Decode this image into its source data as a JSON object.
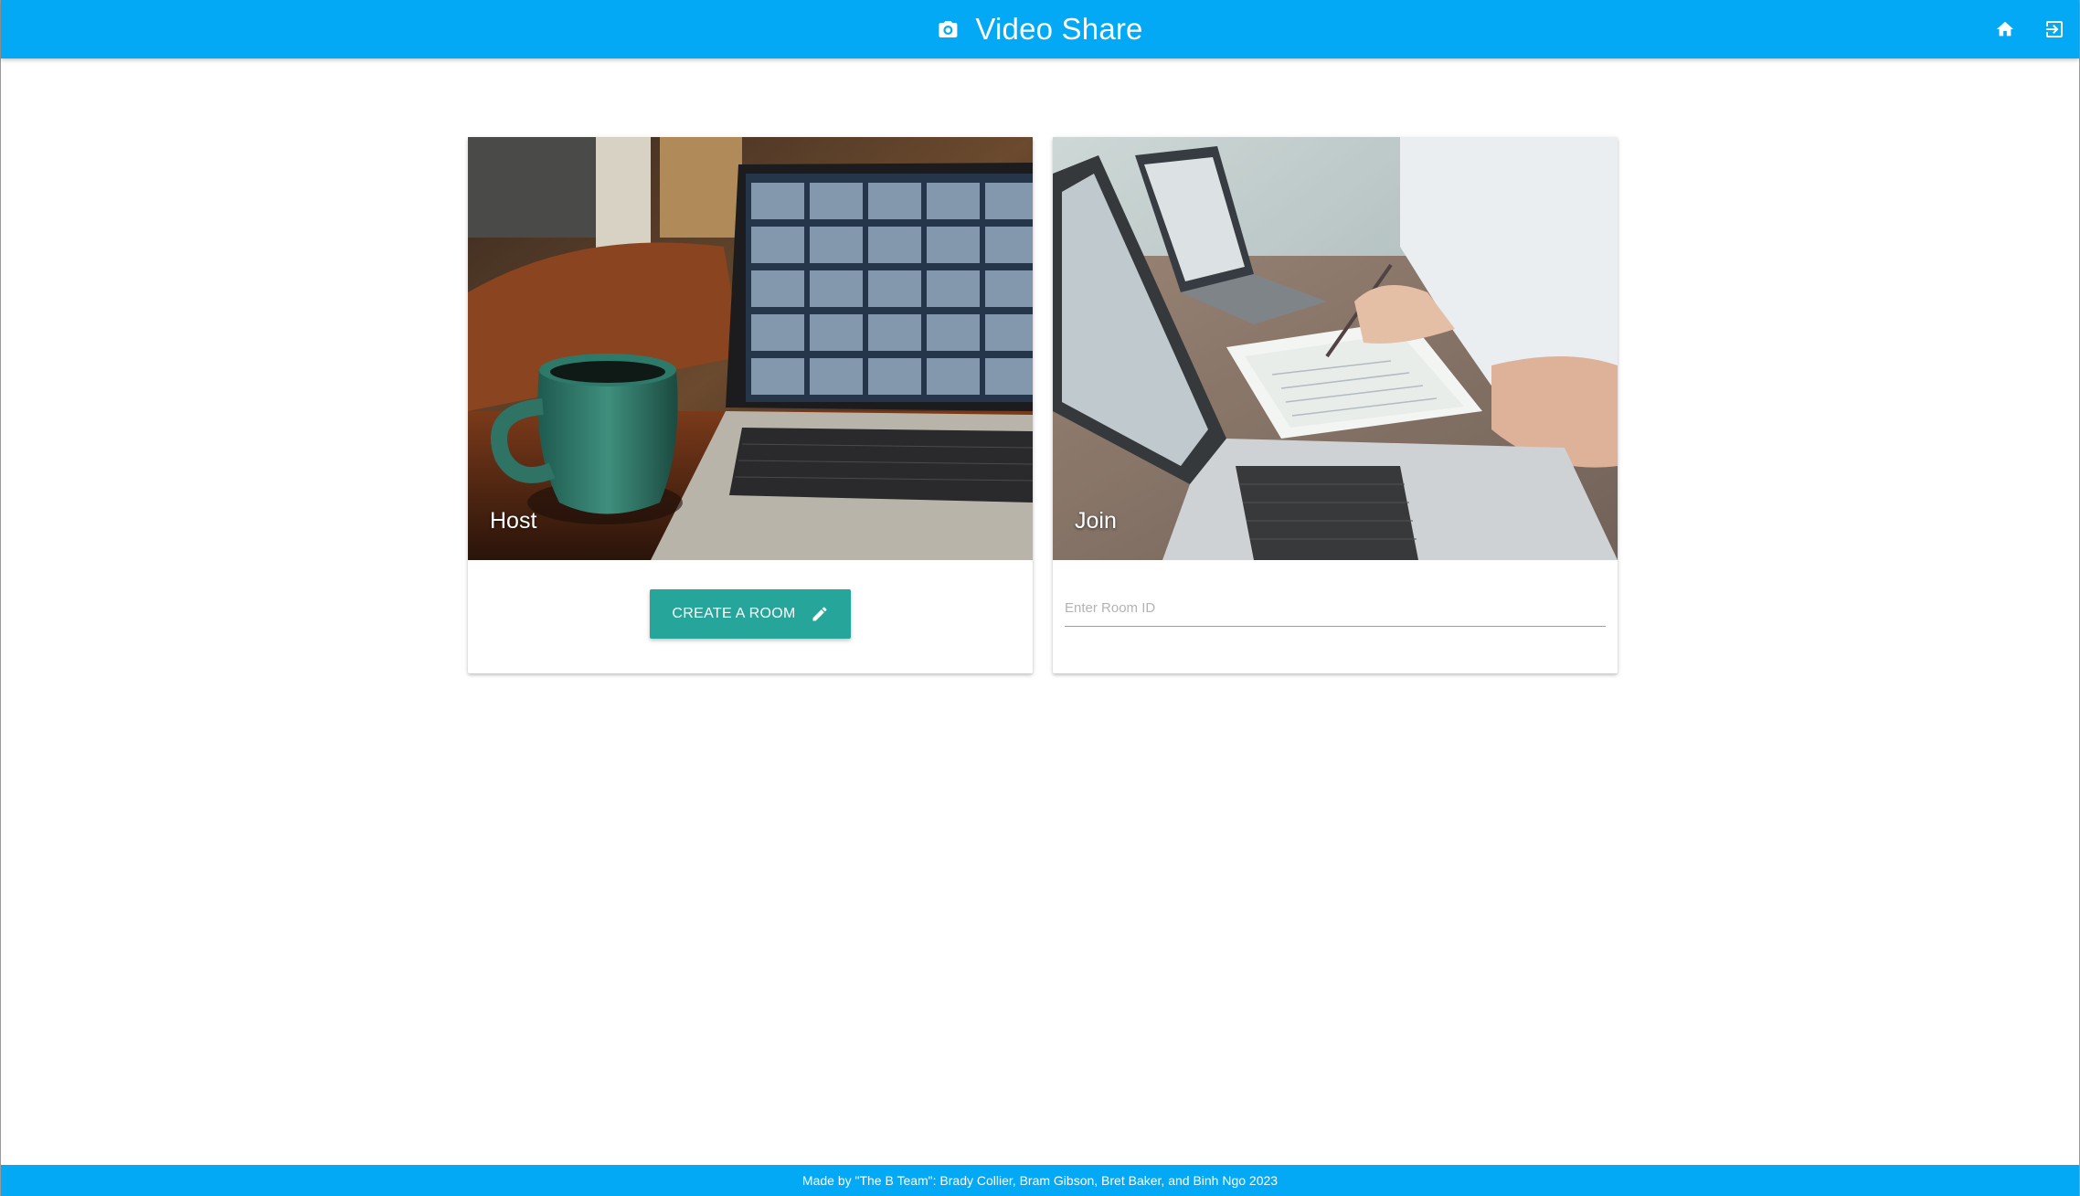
{
  "header": {
    "brand_icon": "camera-icon",
    "title": "Video Share",
    "home_icon": "home-icon",
    "logout_icon": "logout-icon"
  },
  "host_card": {
    "title": "Host",
    "image": "laptop-video-call-with-green-mug-photo",
    "button_label": "CREATE A ROOM",
    "button_icon": "pencil-icon"
  },
  "join_card": {
    "title": "Join",
    "image": "people-working-with-laptops-and-papers-photo",
    "input_placeholder": "Enter Room ID",
    "input_value": ""
  },
  "footer": {
    "text": "Made by \"The B Team\": Brady Collier, Bram Gibson, Bret Baker, and Binh Ngo 2023"
  },
  "colors": {
    "primary": "#03a9f4",
    "button": "#26a69a"
  }
}
